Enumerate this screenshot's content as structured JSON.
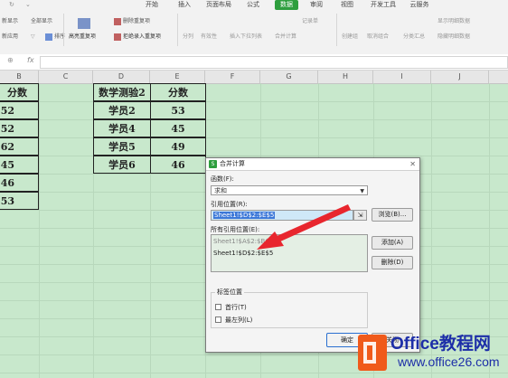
{
  "ribbon": {
    "tabs": [
      "开始",
      "插入",
      "页面布局",
      "公式",
      "数据",
      "审阅",
      "视图",
      "开发工具",
      "云服务"
    ],
    "active_tab": "数据",
    "groups": {
      "reapply": "新显示",
      "all": "新应用",
      "filter_all": "全部显示",
      "sort": "排序",
      "highlight_dup": "高亮重复项",
      "delete_dup": "删除重复项",
      "reject_dup": "拒绝录入重复项",
      "split": "分列",
      "validity": "有效性",
      "insert_dropdown": "插入下拉列表",
      "consolidate": "合并计算",
      "record": "记录单",
      "create_group": "创建组",
      "ungroup": "取消组合",
      "subtotal": "分类汇总",
      "show_detail": "显示明细数据",
      "hide_detail": "隐藏明细数据"
    }
  },
  "formula_bar": {
    "fx": "fx",
    "value": ""
  },
  "columns": [
    "B",
    "C",
    "D",
    "E",
    "F",
    "G",
    "H",
    "I",
    "J"
  ],
  "left_table": {
    "header": "分数",
    "values": [
      "52",
      "52",
      "62",
      "45",
      "46",
      "53"
    ]
  },
  "right_table": {
    "headers": [
      "数学测验2",
      "分数"
    ],
    "rows": [
      [
        "学员2",
        "53"
      ],
      [
        "学员4",
        "45"
      ],
      [
        "学员5",
        "49"
      ],
      [
        "学员6",
        "46"
      ]
    ]
  },
  "dialog": {
    "title": "合并计算",
    "function_label": "函数(F):",
    "function_value": "求和",
    "reference_label": "引用位置(R):",
    "reference_value": "Sheet1!$D$2:$E$5",
    "browse_button": "浏览(B)...",
    "all_references_label": "所有引用位置(E):",
    "all_references": [
      "Sheet1!$A$2:$B$",
      "Sheet1!$D$2:$E$5"
    ],
    "add_button": "添加(A)",
    "delete_button": "删除(D)",
    "labels_group": "标签位置",
    "first_row": "首行(T)",
    "left_column": "最左列(L)",
    "ok_button": "确定",
    "close_button": "关闭"
  },
  "watermark": {
    "title": "Office教程网",
    "url": "www.office26.com"
  },
  "colors": {
    "accent": "#2e9e3e",
    "grid_bg": "#c8e8cc",
    "arrow": "#e8262e",
    "watermark": "#1d2ea8"
  }
}
